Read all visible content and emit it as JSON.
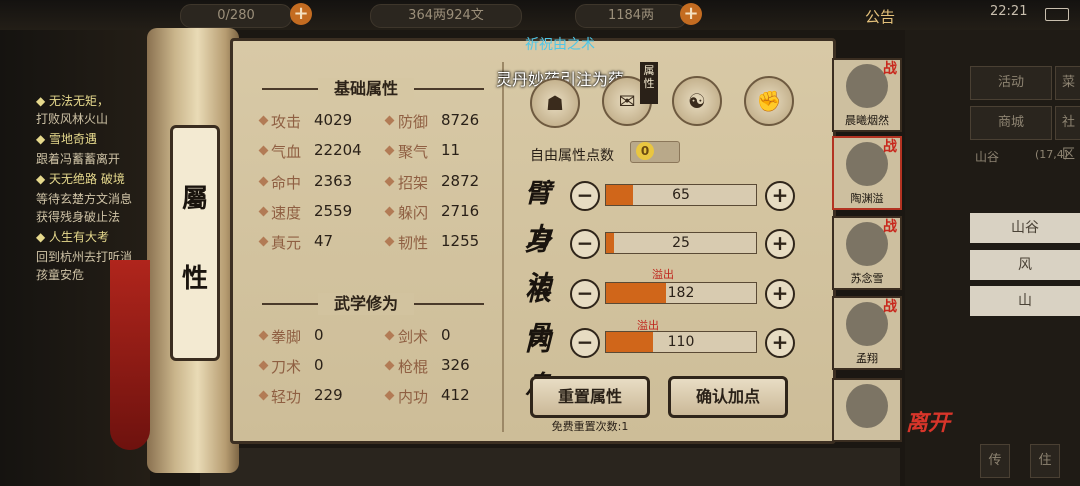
{
  "topbar": {
    "stamina": "0/280",
    "money": "364两924文",
    "gold": "1184两",
    "announcement": "公告",
    "time": "22:21",
    "battery_icon": "battery-icon",
    "plus": "+"
  },
  "quests": [
    {
      "title": "◆ 无法无矩，",
      "desc": "打败风林火山"
    },
    {
      "title": "◆ 雪地奇遇",
      "desc": "跟着冯蓄蓄离开"
    },
    {
      "title": "◆ 天无绝路 破境",
      "desc": "等待玄楚方文消息",
      "desc2": "获得残身破止法"
    },
    {
      "title": "◆ 人生有大考",
      "desc": "回到杭州去打听消",
      "desc2": "孩童安危"
    }
  ],
  "right_menu": {
    "activity": "活动",
    "shop_top": "菜单",
    "mall": "商城",
    "community": "社区",
    "location": "山谷",
    "coords": "(17,4)",
    "list": [
      "山谷",
      "风",
      "山"
    ],
    "bottom1": "传",
    "bottom2": "住"
  },
  "scroll": {
    "roller_label_1": "屬",
    "roller_label_2": "性"
  },
  "basic": {
    "heading": "基础属性",
    "stats": [
      {
        "label": "攻击",
        "value": "4029"
      },
      {
        "label": "防御",
        "value": "8726"
      },
      {
        "label": "气血",
        "value": "22204"
      },
      {
        "label": "聚气",
        "value": "11"
      },
      {
        "label": "命中",
        "value": "2363"
      },
      {
        "label": "招架",
        "value": "2872"
      },
      {
        "label": "速度",
        "value": "2559"
      },
      {
        "label": "躲闪",
        "value": "2716"
      },
      {
        "label": "真元",
        "value": "47"
      },
      {
        "label": "韧性",
        "value": "1255"
      }
    ]
  },
  "martial": {
    "heading": "武学修为",
    "stats": [
      {
        "label": "拳脚",
        "value": "0"
      },
      {
        "label": "剑术",
        "value": "0"
      },
      {
        "label": "刀术",
        "value": "0"
      },
      {
        "label": "枪棍",
        "value": "326"
      },
      {
        "label": "轻功",
        "value": "229"
      },
      {
        "label": "内功",
        "value": "412"
      }
    ]
  },
  "right": {
    "title": "祈祝由之术",
    "subtitle": "灵丹妙药引注为蕴",
    "attr_tag": "属性",
    "free_points_label": "自由属性点数",
    "free_points": "0",
    "attributes": [
      {
        "name": "臂力",
        "value": "65",
        "fraction": 0.18,
        "overflow": ""
      },
      {
        "name": "身法",
        "value": "25",
        "fraction": 0.05,
        "overflow": ""
      },
      {
        "name": "根骨",
        "value": "182",
        "fraction": 0.4,
        "overflow": "溢出"
      },
      {
        "name": "内息",
        "value": "110",
        "fraction": 0.31,
        "overflow": "溢出"
      }
    ],
    "reset_button": "重置属性",
    "confirm_button": "确认加点",
    "reset_note": "免费重置次数:1"
  },
  "characters": [
    {
      "name": "晨曦烟然",
      "tag": "战"
    },
    {
      "name": "陶渊溢",
      "tag": "战"
    },
    {
      "name": "苏念雪",
      "tag": "战"
    },
    {
      "name": "孟翔",
      "tag": "战"
    },
    {
      "name": "",
      "tag": ""
    }
  ],
  "leave": "离开",
  "colors": {
    "accent_orange": "#d0661a",
    "overflow_red": "#c0261e",
    "title_cyan": "#4fc7e8"
  }
}
